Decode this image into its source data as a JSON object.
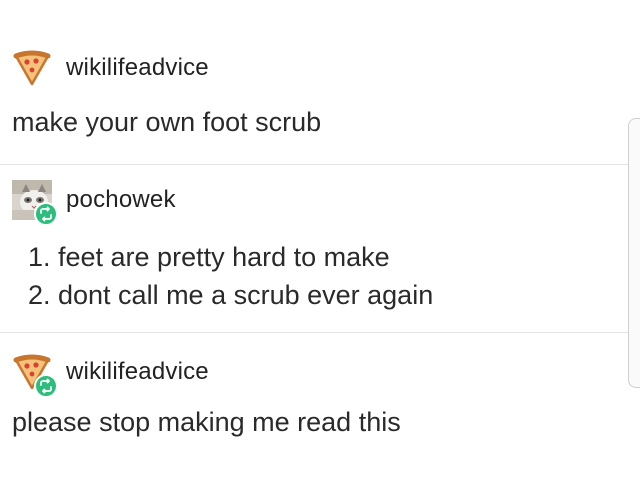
{
  "posts": [
    {
      "username": "wikilifeadvice",
      "avatar": "pizza-icon",
      "reblogged": false,
      "text": "make your own foot scrub"
    },
    {
      "username": "pochowek",
      "avatar": "cat-photo",
      "reblogged": true,
      "items": [
        {
          "num": "1.",
          "text": "feet are pretty hard to make"
        },
        {
          "num": "2.",
          "text": "dont call me a scrub ever again"
        }
      ]
    },
    {
      "username": "wikilifeadvice",
      "avatar": "pizza-icon",
      "reblogged": true,
      "text": "please stop making me read this"
    }
  ],
  "colors": {
    "reblog_badge": "#2dbd7c",
    "pizza_crust": "#c8762e",
    "pizza_cheese": "#f4c27a",
    "pizza_pepperoni": "#d7442e",
    "divider": "#e4e4e4"
  }
}
